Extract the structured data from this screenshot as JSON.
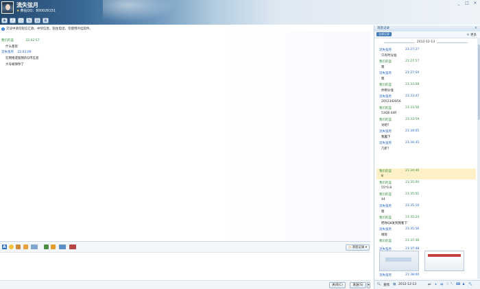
{
  "header": {
    "contact_name": "流失弦月",
    "contact_sub": "黄钻QQ：800026151",
    "window_controls": [
      "_",
      "□",
      "×"
    ]
  },
  "toolbar": {
    "icons": [
      "video-icon",
      "voice-icon",
      "file-transfer-icon",
      "remote-assist-icon",
      "share-icon",
      "app-icon"
    ]
  },
  "notice": "交谈中请勿轻信汇款、中奖信息，陌生电话，勿使用外挂软件。",
  "chat": {
    "messages": [
      {
        "sender": "我们的蓝",
        "time": "22:02:57",
        "color": "green",
        "lines": [
          "什么意思"
        ]
      },
      {
        "sender": "流失弦月",
        "time": "22:03:09",
        "color": "blue",
        "lines": [
          "在网络遗留我的Q币信息",
          "大号被保你了"
        ]
      }
    ]
  },
  "edit_toolbar": {
    "history_label": "消息记录"
  },
  "bottom": {
    "close_label": "关闭(C)",
    "send_label": "发送(S)"
  },
  "history": {
    "title": "消息记录",
    "tab": "全部记录",
    "more": "更多",
    "date": "2012-12-13",
    "entries": [
      {
        "sender": "流失弦月",
        "time": "21:27:27",
        "color": "blue",
        "body": "只有时分准"
      },
      {
        "sender": "我们的蓝",
        "time": "21:27:57",
        "color": "green",
        "body": "嗯"
      },
      {
        "sender": "流失弦月",
        "time": "21:27:59",
        "color": "blue",
        "body": "嗯"
      },
      {
        "sender": "我们的蓝",
        "time": "21:33:08",
        "color": "green",
        "body": "你刚分准"
      },
      {
        "sender": "流失弦月",
        "time": "21:33:47",
        "color": "blue",
        "body": "2052342856"
      },
      {
        "sender": "我们的蓝",
        "time": "21:33:56",
        "color": "green",
        "body": "53Q8 44R"
      },
      {
        "sender": "我们的蓝",
        "time": "21:33:59",
        "color": "green",
        "body": "对吧？"
      },
      {
        "sender": "流失弦月",
        "time": "21:34:05",
        "color": "blue",
        "body": "我露下"
      },
      {
        "sender": "流失弦月",
        "time": "21:34:35",
        "color": "blue",
        "body": "几折？"
      },
      {
        "sender": "我们的蓝",
        "time": "21:34:46",
        "color": "green",
        "body": "8",
        "highlight": true
      },
      {
        "sender": "我们的蓝",
        "time": "21:35:00",
        "color": "green",
        "body": "55*0.8"
      },
      {
        "sender": "我们的蓝",
        "time": "21:35:01",
        "color": "green",
        "body": "44"
      },
      {
        "sender": "流失弦月",
        "time": "21:35:10",
        "color": "blue",
        "body": "嗯"
      },
      {
        "sender": "我们的蓝",
        "time": "21:35:24",
        "color": "green",
        "body": "把你Q8发到我看下"
      },
      {
        "sender": "流失弦月",
        "time": "21:35:56",
        "color": "blue",
        "body": "稍等"
      },
      {
        "sender": "我们的蓝",
        "time": "21:37:46",
        "color": "green",
        "body": ".."
      },
      {
        "sender": "流失弦月",
        "time": "21:37:48",
        "color": "blue",
        "body": ""
      },
      {
        "sender": "流失弦月",
        "time": "21:38:00",
        "color": "blue",
        "body": "我那的链接打不开"
      }
    ],
    "footer": {
      "search_label": "查找",
      "date_value": "2012-12-13"
    }
  }
}
